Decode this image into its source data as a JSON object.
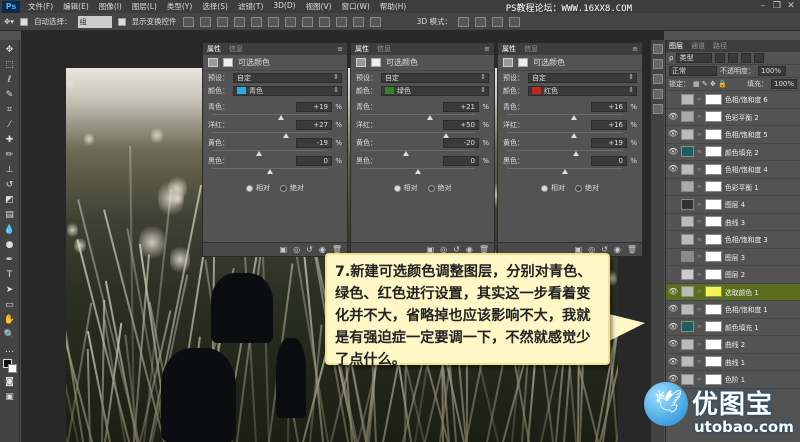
{
  "menubar": {
    "app_icon": "Ps",
    "items": [
      "文件(F)",
      "编辑(E)",
      "图像(I)",
      "图层(L)",
      "类型(Y)",
      "选择(S)",
      "滤镜(T)",
      "3D(D)",
      "视图(V)",
      "窗口(W)",
      "帮助(H)"
    ],
    "watermark": "PS教程论坛：WWW.16XX8.COM"
  },
  "options_bar": {
    "auto_select_label": "自动选择：",
    "auto_select_value": "组",
    "transform_label": "显示变换控件",
    "mode_label": "3D 模式："
  },
  "properties_panels": [
    {
      "tab_active": "属性",
      "tab_inactive": "信息",
      "title": "可选颜色",
      "preset_label": "预设：",
      "preset_value": "自定",
      "color_label": "颜色：",
      "color_value": "青色",
      "color_swatch": "#29a9e0",
      "sliders": [
        {
          "name": "青色：",
          "value": "+19",
          "pos": 0.595
        },
        {
          "name": "洋红：",
          "value": "+27",
          "pos": 0.635
        },
        {
          "name": "黄色：",
          "value": "-19",
          "pos": 0.405
        },
        {
          "name": "黑色：",
          "value": "0",
          "pos": 0.5
        }
      ],
      "relative": "相对",
      "absolute": "绝对"
    },
    {
      "tab_active": "属性",
      "tab_inactive": "信息",
      "title": "可选颜色",
      "preset_label": "预设：",
      "preset_value": "自定",
      "color_label": "颜色：",
      "color_value": "绿色",
      "color_swatch": "#2a8a1e",
      "sliders": [
        {
          "name": "青色：",
          "value": "+21",
          "pos": 0.605
        },
        {
          "name": "洋红：",
          "value": "+50",
          "pos": 0.75
        },
        {
          "name": "黄色：",
          "value": "-20",
          "pos": 0.4
        },
        {
          "name": "黑色：",
          "value": "0",
          "pos": 0.5
        }
      ],
      "relative": "相对",
      "absolute": "绝对"
    },
    {
      "tab_active": "属性",
      "tab_inactive": "信息",
      "title": "可选颜色",
      "preset_label": "预设：",
      "preset_value": "自定",
      "color_label": "颜色：",
      "color_value": "红色",
      "color_swatch": "#c0281b",
      "sliders": [
        {
          "name": "青色：",
          "value": "+16",
          "pos": 0.58
        },
        {
          "name": "洋红：",
          "value": "+16",
          "pos": 0.58
        },
        {
          "name": "黄色：",
          "value": "+19",
          "pos": 0.595
        },
        {
          "name": "黑色：",
          "value": "0",
          "pos": 0.5
        }
      ],
      "relative": "相对",
      "absolute": "绝对"
    }
  ],
  "callout": {
    "text": "7.新建可选颜色调整图层，分别对青色、绿色、红色进行设置，其实这一步看着变化并不大，省略掉也应该影响不大，我就是有强迫症一定要调一下，不然就感觉少了点什么。"
  },
  "layers_panel": {
    "tabs": [
      "图层",
      "通道",
      "路径"
    ],
    "kind_label": "类型",
    "blend_mode": "正常",
    "opacity_label": "不透明度：",
    "opacity_value": "100%",
    "lock_label": "锁定：",
    "fill_label": "填充：",
    "fill_value": "100%",
    "rows": [
      {
        "name": "色相/饱和度 6",
        "thumb": "#bbbbbb",
        "visible": false
      },
      {
        "name": "色彩平衡 2",
        "thumb": "#aaaaaa",
        "visible": true
      },
      {
        "name": "色相/饱和度 5",
        "thumb": "#bbbbbb",
        "visible": true
      },
      {
        "name": "颜色填充 2",
        "thumb": "#1a5e5e",
        "visible": true
      },
      {
        "name": "色相/饱和度 4",
        "thumb": "#bbbbbb",
        "visible": true
      },
      {
        "name": "色彩平衡 1",
        "thumb": "#aaaaaa",
        "visible": false
      },
      {
        "name": "图层 4",
        "thumb": "#333333",
        "visible": false
      },
      {
        "name": "曲线 3",
        "thumb": "#bbbbbb",
        "visible": false
      },
      {
        "name": "色相/饱和度 3",
        "thumb": "#bbbbbb",
        "visible": false
      },
      {
        "name": "图层 3",
        "thumb": "#8a8a8a",
        "visible": false
      },
      {
        "name": "图层 2",
        "thumb": "#cccccc",
        "visible": false
      },
      {
        "name": "选取颜色 1",
        "thumb": "#bbbbbb",
        "visible": true,
        "selected": true
      },
      {
        "name": "色相/饱和度 1",
        "thumb": "#bbbbbb",
        "visible": true
      },
      {
        "name": "颜色填充 1",
        "thumb": "#1a5e5e",
        "visible": true
      },
      {
        "name": "曲线 2",
        "thumb": "#bbbbbb",
        "visible": true
      },
      {
        "name": "曲线 1",
        "thumb": "#bbbbbb",
        "visible": true
      },
      {
        "name": "色阶 1",
        "thumb": "#bbbbbb",
        "visible": true
      }
    ]
  },
  "logo": {
    "cn": "优图宝",
    "en": "utobao.com"
  }
}
